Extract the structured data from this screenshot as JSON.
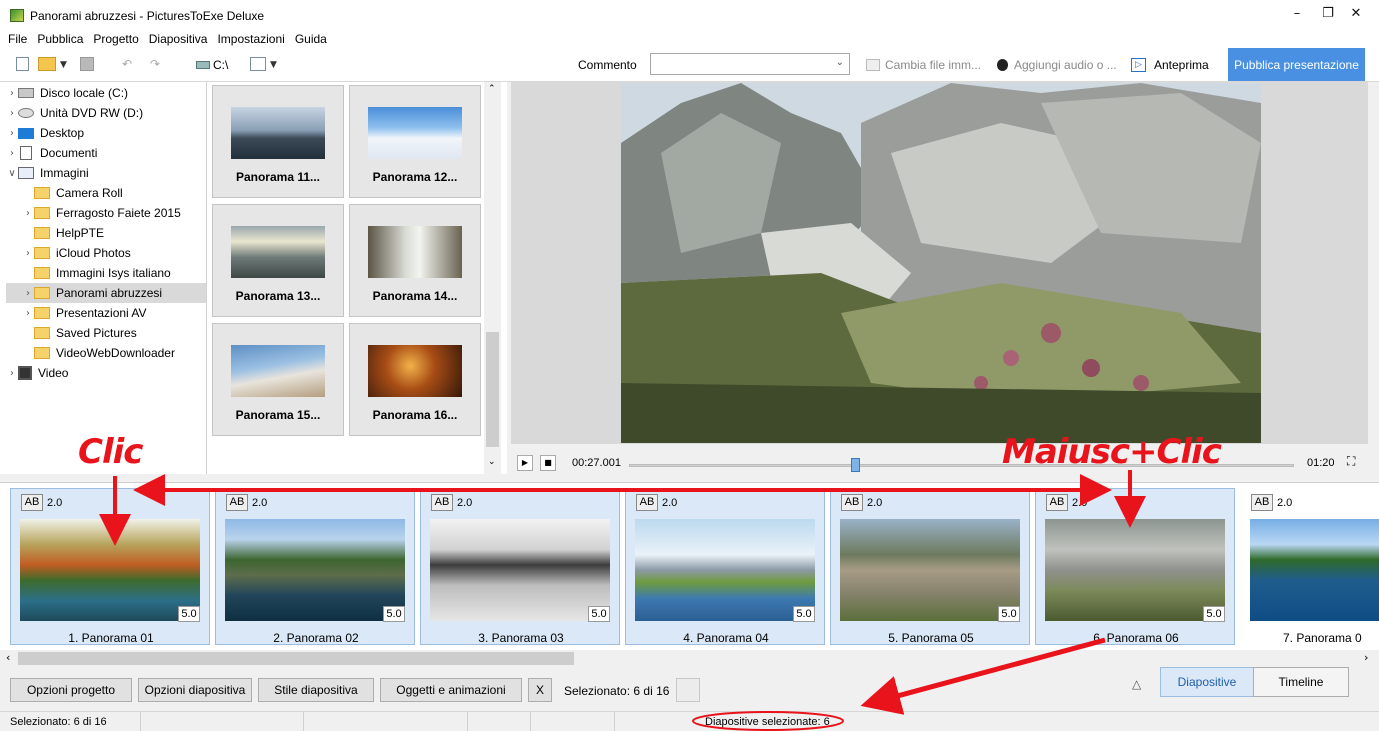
{
  "window": {
    "title": "Panorami abruzzesi - PicturesToExe Deluxe",
    "minimize": "–",
    "maximize": "❐",
    "close": "✕"
  },
  "menu": [
    "File",
    "Pubblica",
    "Progetto",
    "Diapositiva",
    "Impostazioni",
    "Guida"
  ],
  "toolbar": {
    "drive_label": "C:\\",
    "comment_label": "Commento",
    "comment_value": "",
    "change_image": "Cambia file imm...",
    "add_audio": "Aggiungi audio o ...",
    "preview": "Anteprima",
    "publish": "Pubblica presentazione"
  },
  "tree": [
    {
      "label": "Disco locale (C:)",
      "icon": "drive-icon",
      "chev": "›"
    },
    {
      "label": "Unità DVD RW (D:)",
      "icon": "dvd-icon",
      "chev": "›"
    },
    {
      "label": "Desktop",
      "icon": "desktop-icon",
      "chev": "›"
    },
    {
      "label": "Documenti",
      "icon": "document-icon",
      "chev": "›"
    },
    {
      "label": "Immagini",
      "icon": "pictures-icon",
      "chev": "∨"
    },
    {
      "label": "Camera Roll",
      "icon": "folder-icon",
      "chev": ""
    },
    {
      "label": "Ferragosto Faiete 2015",
      "icon": "folder-icon",
      "chev": "›"
    },
    {
      "label": "HelpPTE",
      "icon": "folder-icon",
      "chev": ""
    },
    {
      "label": "iCloud Photos",
      "icon": "folder-icon",
      "chev": "›"
    },
    {
      "label": "Immagini Isys italiano",
      "icon": "folder-icon",
      "chev": ""
    },
    {
      "label": "Panorami abruzzesi",
      "icon": "folder-icon",
      "chev": "›",
      "selected": true
    },
    {
      "label": "Presentazioni AV",
      "icon": "folder-icon",
      "chev": "›"
    },
    {
      "label": "Saved Pictures",
      "icon": "folder-icon",
      "chev": ""
    },
    {
      "label": "VideoWebDownloader",
      "icon": "folder-icon",
      "chev": ""
    },
    {
      "label": "Video",
      "icon": "video-icon",
      "chev": "›"
    }
  ],
  "thumbs": [
    {
      "label": "Panorama 11..."
    },
    {
      "label": "Panorama 12..."
    },
    {
      "label": "Panorama 13..."
    },
    {
      "label": "Panorama 14..."
    },
    {
      "label": "Panorama 15..."
    },
    {
      "label": "Panorama 16..."
    }
  ],
  "player": {
    "current_time": "00:27.001",
    "total_time": "01:20",
    "position_fraction": 0.34
  },
  "slides": [
    {
      "ab": "AB",
      "transition": "2.0",
      "duration": "5.0",
      "name": "1. Panorama 01",
      "selected": true
    },
    {
      "ab": "AB",
      "transition": "2.0",
      "duration": "5.0",
      "name": "2. Panorama 02",
      "selected": true
    },
    {
      "ab": "AB",
      "transition": "2.0",
      "duration": "5.0",
      "name": "3. Panorama 03",
      "selected": true
    },
    {
      "ab": "AB",
      "transition": "2.0",
      "duration": "5.0",
      "name": "4. Panorama 04",
      "selected": true
    },
    {
      "ab": "AB",
      "transition": "2.0",
      "duration": "5.0",
      "name": "5. Panorama 05",
      "selected": true
    },
    {
      "ab": "AB",
      "transition": "2.0",
      "duration": "5.0",
      "name": "6. Panorama 06",
      "selected": true
    },
    {
      "ab": "AB",
      "transition": "2.0",
      "duration": "",
      "name": "7. Panorama 0",
      "selected": false
    }
  ],
  "bottom": {
    "project_options": "Opzioni progetto",
    "slide_options": "Opzioni diapositiva",
    "slide_style": "Stile diapositiva",
    "objects": "Oggetti e animazioni",
    "x": "X",
    "selected": "Selezionato: 6 di 16",
    "up_arrow": "△",
    "tab_slides": "Diapositive",
    "tab_timeline": "Timeline"
  },
  "status": {
    "left": "Selezionato: 6 di 16",
    "middle": "Diapositive selezionate: 6"
  },
  "annotations": {
    "click": "Clic",
    "shift_click": "Maiusc+Clic"
  },
  "colors": {
    "accent": "#4a90e2",
    "annotation": "#e8131b",
    "selected_slide": "#dbe8f7"
  }
}
